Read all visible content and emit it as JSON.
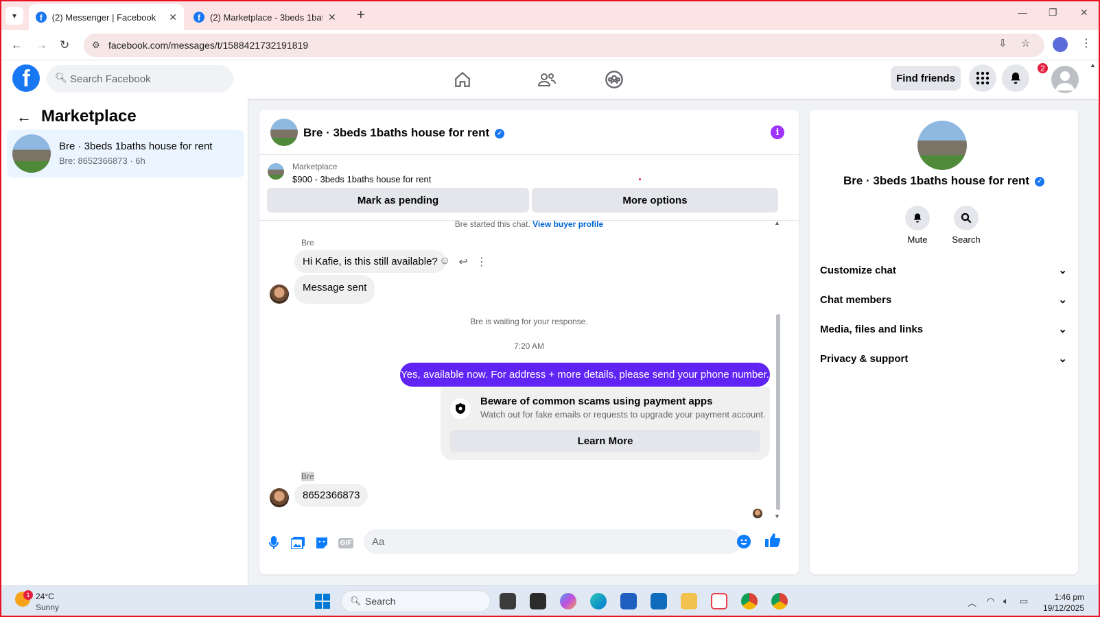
{
  "browser": {
    "tabs": [
      {
        "title": "(2) Messenger | Facebook"
      },
      {
        "title": "(2) Marketplace - 3beds 1baths"
      }
    ],
    "url": "facebook.com/messages/t/1588421732191819"
  },
  "fb_header": {
    "search_placeholder": "Search Facebook",
    "find_friends": "Find friends",
    "notification_count": "2"
  },
  "left_pane": {
    "title": "Marketplace",
    "conversation": {
      "name": "Bre · 3beds 1baths house for rent",
      "preview": "Bre: 8652366873 · 6h"
    }
  },
  "chat": {
    "header_name": "Bre · 3beds 1baths house for rent",
    "marketplace_label": "Marketplace",
    "listing": "$900 - 3beds 1baths house for rent",
    "mark_pending": "Mark as pending",
    "more_options": "More options",
    "started_text": "Bre started this chat.",
    "view_buyer": "View buyer profile",
    "messages": {
      "sender1": "Bre",
      "msg1": "Hi Kafie, is this still available?",
      "msg2": "Message sent",
      "waiting": "Bre is waiting for your response.",
      "time": "7:20 AM",
      "outgoing": "Yes, available now. For address + more details, please send your phone number.",
      "sender2": "Bre",
      "msg3": "8652366873"
    },
    "scam_card": {
      "title": "Beware of common scams using payment apps",
      "subtitle": "Watch out for fake emails or requests to upgrade your payment account.",
      "button": "Learn More"
    },
    "composer_placeholder": "Aa",
    "gif_label": "GIF"
  },
  "right_pane": {
    "name": "Bre · 3beds 1baths house for rent",
    "mute": "Mute",
    "search": "Search",
    "sections": [
      "Customize chat",
      "Chat members",
      "Media, files and links",
      "Privacy & support"
    ]
  },
  "taskbar": {
    "weather_badge": "1",
    "temperature": "24°C",
    "condition": "Sunny",
    "search": "Search",
    "time": "1:46 pm",
    "date": "19/12/2025"
  },
  "colors": {
    "facebook_blue": "#1877f2",
    "outgoing_bubble": "#6025f5",
    "messenger_blue": "#0a7cff"
  }
}
